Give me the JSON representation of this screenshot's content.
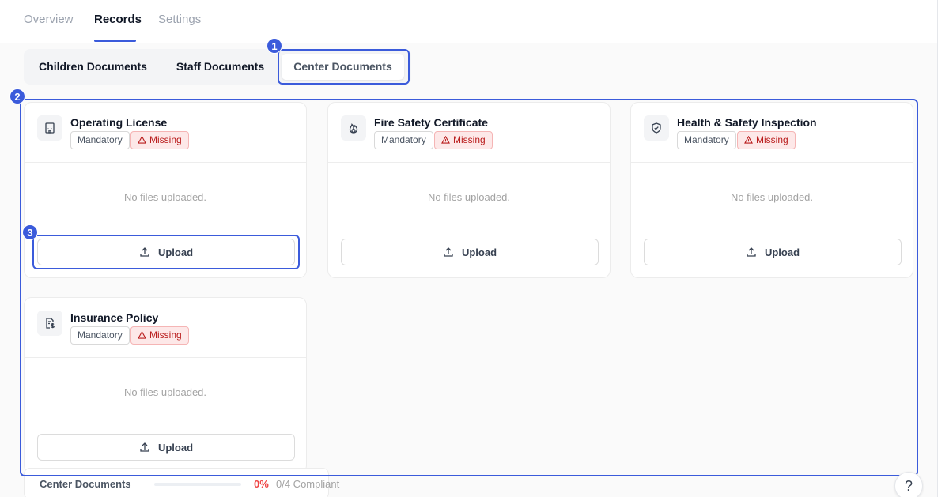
{
  "main_tabs": [
    {
      "label": "Overview"
    },
    {
      "label": "Records"
    },
    {
      "label": "Settings"
    }
  ],
  "active_main_tab": "Records",
  "sub_tabs": [
    {
      "label": "Children Documents"
    },
    {
      "label": "Staff Documents"
    },
    {
      "label": "Center Documents"
    }
  ],
  "active_sub_tab": "Center Documents",
  "documents": [
    {
      "title": "Operating License",
      "icon": "building-icon",
      "mandatory_label": "Mandatory",
      "status_label": "Missing",
      "empty_text": "No files uploaded.",
      "upload_label": "Upload"
    },
    {
      "title": "Fire Safety Certificate",
      "icon": "flame-icon",
      "mandatory_label": "Mandatory",
      "status_label": "Missing",
      "empty_text": "No files uploaded.",
      "upload_label": "Upload"
    },
    {
      "title": "Health & Safety Inspection",
      "icon": "shield-check-icon",
      "mandatory_label": "Mandatory",
      "status_label": "Missing",
      "empty_text": "No files uploaded.",
      "upload_label": "Upload"
    },
    {
      "title": "Insurance Policy",
      "icon": "file-dollar-icon",
      "mandatory_label": "Mandatory",
      "status_label": "Missing",
      "empty_text": "No files uploaded.",
      "upload_label": "Upload"
    }
  ],
  "footer": {
    "label": "Center Documents",
    "percent_text": "0%",
    "compliance_text": "0/4 Compliant",
    "progress_fraction": 0
  },
  "help_label": "?",
  "annotations": [
    "1",
    "2",
    "3"
  ],
  "colors": {
    "accent": "#3b5bdb",
    "missing_bg": "#fde8e8",
    "missing_text": "#b91c1c",
    "progress_red": "#dc2626"
  }
}
